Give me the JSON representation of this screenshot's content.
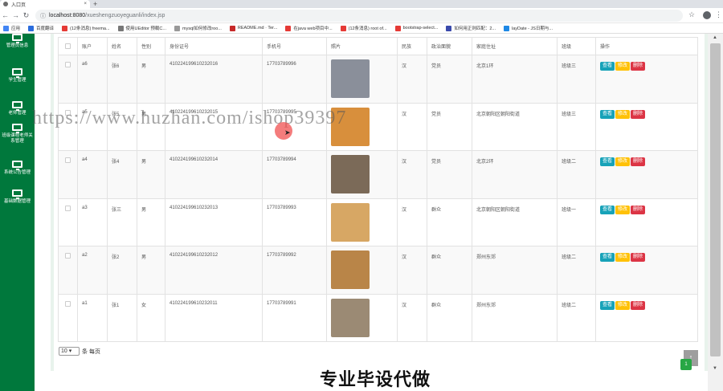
{
  "browser": {
    "tab_title": "入口页",
    "new_tab": "+",
    "close": "×",
    "url_host": "localhost:8080",
    "url_path": "/xueshengzuoyeguanli/index.jsp",
    "star": "☆",
    "menu": "⋮"
  },
  "bookmarks": [
    {
      "label": "应用",
      "color": "#4285f4"
    },
    {
      "label": "百度翻译",
      "color": "#2a6cdd"
    },
    {
      "label": "(12条消息) freema...",
      "color": "#e53935"
    },
    {
      "label": "使用UEditor 预载C...",
      "color": "#777"
    },
    {
      "label": "mysql如何修改roo...",
      "color": "#999"
    },
    {
      "label": "README.md · Ter...",
      "color": "#c62828"
    },
    {
      "label": "在java web项目中...",
      "color": "#e53935"
    },
    {
      "label": "(12条消息) root of...",
      "color": "#e53935"
    },
    {
      "label": "bootstrap-select...",
      "color": "#e53935"
    },
    {
      "label": "如何用正则匹配：2...",
      "color": "#3949ab"
    },
    {
      "label": "layDate - JS日期与...",
      "color": "#1e88e5"
    }
  ],
  "sidebar": [
    {
      "label": "管理员信息"
    },
    {
      "label": "学生管理"
    },
    {
      "label": "老师管理"
    },
    {
      "label": "班级课程老师关系管理"
    },
    {
      "label": "系统公告管理"
    },
    {
      "label": "基础数据管理"
    }
  ],
  "table": {
    "headers": [
      "账户",
      "姓名",
      "性别",
      "身份证号",
      "手机号",
      "照片",
      "民族",
      "政治面貌",
      "家庭住址",
      "班级",
      "操作"
    ],
    "actions": {
      "view": "查看",
      "edit": "修改",
      "delete": "删除"
    },
    "rows": [
      {
        "account": "a6",
        "name": "张6",
        "gender": "男",
        "id_card": "410224199610232016",
        "phone": "17703789996",
        "ethnicity": "汉",
        "politics": "党员",
        "address": "北京1环",
        "class": "班级三",
        "photo_color": "#8a8f9a"
      },
      {
        "account": "a5",
        "name": "张5",
        "gender": "男",
        "id_card": "410224199610232015",
        "phone": "17703789995",
        "ethnicity": "汉",
        "politics": "党员",
        "address": "北京朝阳区朝阳街道",
        "class": "班级三",
        "photo_color": "#d88f3c"
      },
      {
        "account": "a4",
        "name": "张4",
        "gender": "男",
        "id_card": "410224199610232014",
        "phone": "17703789994",
        "ethnicity": "汉",
        "politics": "党员",
        "address": "北京2环",
        "class": "班级二",
        "photo_color": "#7b6a58"
      },
      {
        "account": "a3",
        "name": "张三",
        "gender": "男",
        "id_card": "410224199610232013",
        "phone": "17703789993",
        "ethnicity": "汉",
        "politics": "群众",
        "address": "北京朝阳区朝阳街道",
        "class": "班级一",
        "photo_color": "#d7a764"
      },
      {
        "account": "a2",
        "name": "张2",
        "gender": "男",
        "id_card": "410224199610232012",
        "phone": "17703789992",
        "ethnicity": "汉",
        "politics": "群众",
        "address": "郑州东郊",
        "class": "班级二",
        "photo_color": "#b98548"
      },
      {
        "account": "a1",
        "name": "张1",
        "gender": "女",
        "id_card": "410224199610232011",
        "phone": "17703789991",
        "ethnicity": "汉",
        "politics": "群众",
        "address": "郑州东郊",
        "class": "班级二",
        "photo_color": "#9b8a74"
      }
    ]
  },
  "pager": {
    "page_size": "10 ▾",
    "suffix": "条 每页"
  },
  "watermark": "https://www.huzhan.com/ishop39397",
  "banner": "专业毕设代做",
  "backtop": "↑",
  "page_badge": "1"
}
